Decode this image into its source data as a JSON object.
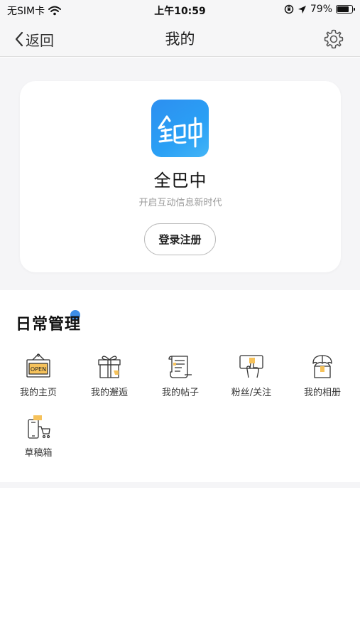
{
  "status_bar": {
    "carrier": "无SIM卡",
    "time": "上午10:59",
    "battery_percent": "79%",
    "battery_level": 0.79
  },
  "nav": {
    "back_label": "返回",
    "title": "我的"
  },
  "profile": {
    "app_name": "全巴中",
    "slogan": "开启互动信息新时代",
    "login_label": "登录注册",
    "accent_color": "#2d8ff0"
  },
  "daily": {
    "title": "日常管理",
    "items": [
      {
        "label": "我的主页",
        "icon": "open-sign-icon"
      },
      {
        "label": "我的邂逅",
        "icon": "gift-box-icon"
      },
      {
        "label": "我的帖子",
        "icon": "document-icon"
      },
      {
        "label": "粉丝/关注",
        "icon": "phone-hand-icon"
      },
      {
        "label": "我的相册",
        "icon": "umbrella-box-icon"
      },
      {
        "label": "草稿箱",
        "icon": "phone-cart-icon"
      }
    ]
  }
}
